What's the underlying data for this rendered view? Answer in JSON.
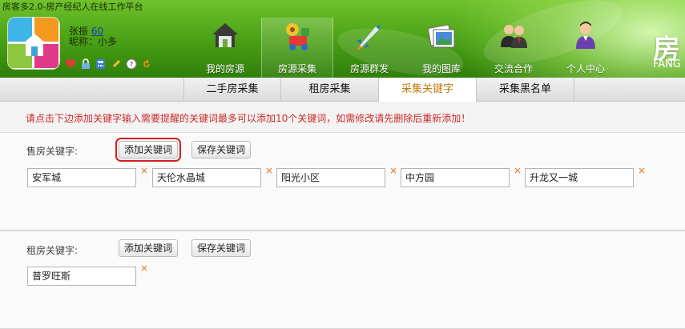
{
  "app": {
    "title": "房客多2.0-房产经纪人在线工作平台"
  },
  "user": {
    "name_label": "张振",
    "score": "60",
    "nickname": "昵称：小多"
  },
  "user_icons": [
    "heart-icon",
    "lock-icon",
    "calculator-icon",
    "pencil-icon",
    "help-icon",
    "refresh-icon"
  ],
  "nav": {
    "items": [
      {
        "label": "我的房源",
        "icon": "house-icon",
        "active": false
      },
      {
        "label": "房源采集",
        "icon": "collect-icon",
        "active": true
      },
      {
        "label": "房源群发",
        "icon": "rocket-icon",
        "active": false
      },
      {
        "label": "我的图库",
        "icon": "gallery-icon",
        "active": false
      },
      {
        "label": "交流合作",
        "icon": "people-icon",
        "active": false
      },
      {
        "label": "个人中心",
        "icon": "person-icon",
        "active": false
      }
    ]
  },
  "brand": {
    "big": "房",
    "small": "FANG"
  },
  "subtabs": {
    "items": [
      {
        "label": "二手房采集",
        "active": false
      },
      {
        "label": "租房采集",
        "active": false
      },
      {
        "label": "采集关键字",
        "active": true
      },
      {
        "label": "采集黑名单",
        "active": false
      }
    ]
  },
  "notice": {
    "text": "请点击下边添加关键字输入需要提醒的关键词最多可以添加10个关键词，如需修改请先删除后重新添加！"
  },
  "sale": {
    "label": "售房关键字:",
    "add_button": "添加关键词",
    "save_button": "保存关键词",
    "keywords": [
      "安军城",
      "天伦水晶城",
      "阳光小区",
      "中方园",
      "升龙又一城"
    ]
  },
  "rent": {
    "label": "租房关键字:",
    "add_button": "添加关键词",
    "save_button": "保存关键词",
    "keywords": [
      "普罗旺斯"
    ]
  },
  "delete_glyph": "×",
  "colors": {
    "header_green": "#4ea517",
    "active_tab_text": "#c07a10",
    "notice_red": "#cc2a2a",
    "highlight_red": "#d41f1f",
    "delete_orange": "#e0771b"
  }
}
